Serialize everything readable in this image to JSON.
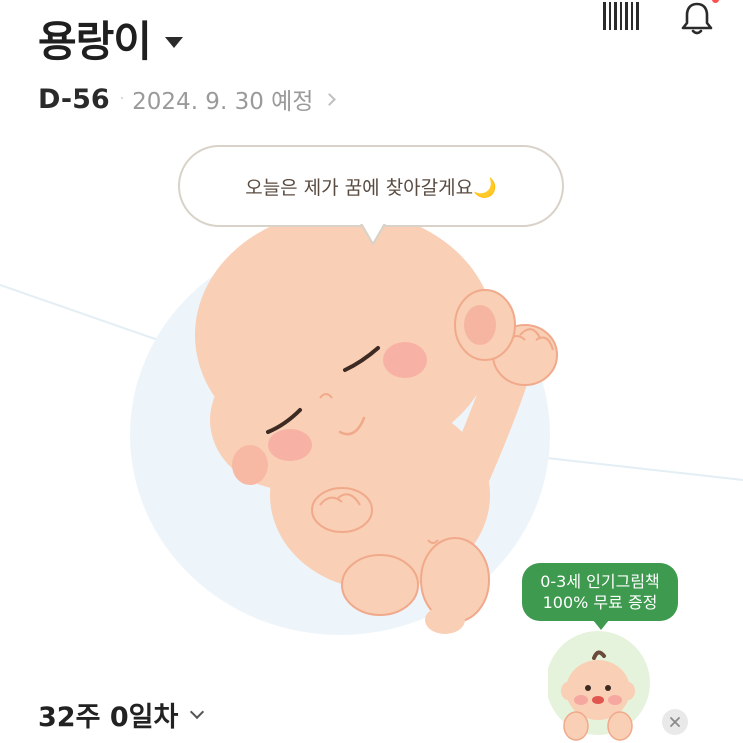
{
  "header": {
    "title": "용랑이",
    "dday": "D-56",
    "separator": "·",
    "due_date": "2024. 9. 30 예정"
  },
  "top_icons": [
    {
      "name": "barcode-icon"
    },
    {
      "name": "bell-icon",
      "has_badge": true
    }
  ],
  "bubble": {
    "message": "오늘은 제가 꿈에 찾아갈게요🌙"
  },
  "promo": {
    "line1": "0-3세 인기그림책",
    "line2": "100% 무료 증정"
  },
  "week": {
    "label": "32주 0일차"
  },
  "colors": {
    "promo_green": "#3d9a4e",
    "skin": "#f7c9ae",
    "badge_red": "#ff4d4d"
  }
}
